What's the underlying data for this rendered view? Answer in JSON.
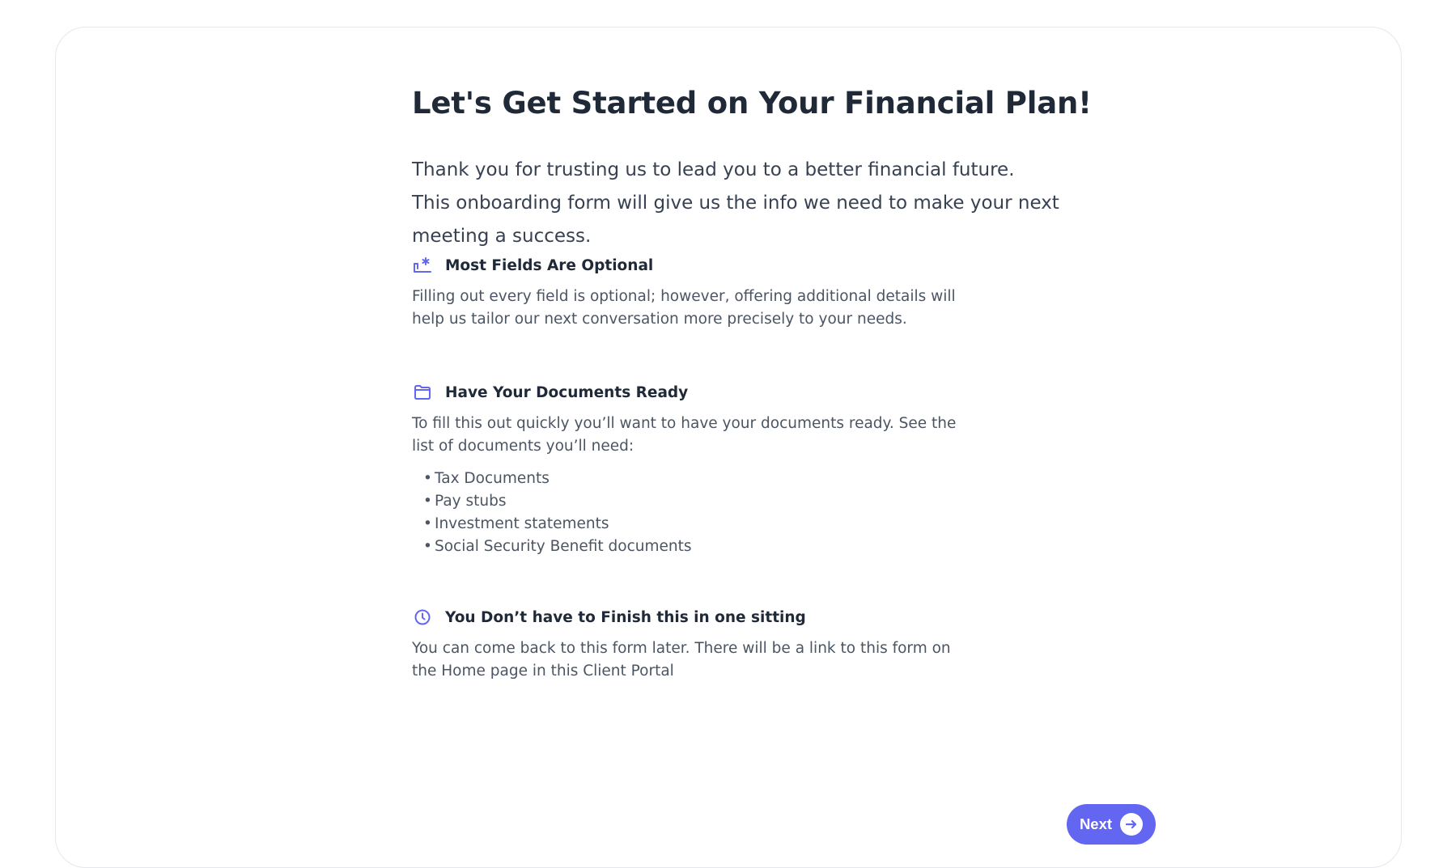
{
  "page": {
    "title": "Let's Get Started on Your Financial Plan!",
    "intro_line_1": "Thank you for trusting us to lead you to a better financial future.",
    "intro_line_2": "This onboarding form will give us the info we need to make your next meeting a success."
  },
  "sections": [
    {
      "icon": "form-asterisk-icon",
      "title": "Most Fields Are Optional",
      "body": "Filling out every field is optional; however, offering additional details will help us tailor our next conversation more precisely to your needs."
    },
    {
      "icon": "folder-icon",
      "title": "Have Your Documents Ready",
      "body": "To fill this out quickly you’ll want to have your documents ready. See the list of documents you’ll need:",
      "documents": [
        "Tax Documents",
        "Pay stubs",
        "Investment statements",
        "Social Security Benefit documents"
      ]
    },
    {
      "icon": "clock-icon",
      "title": "You Don’t have to Finish this in one sitting",
      "body": "You can come back to this form later. There will be a link to this form on the Home page in this Client Portal"
    }
  ],
  "actions": {
    "next_label": "Next",
    "next_icon": "arrow-right-circle-icon"
  },
  "colors": {
    "accent": "#6366f1",
    "heading": "#1f2937",
    "body": "#4b5563",
    "card_border": "#e5e7eb"
  }
}
